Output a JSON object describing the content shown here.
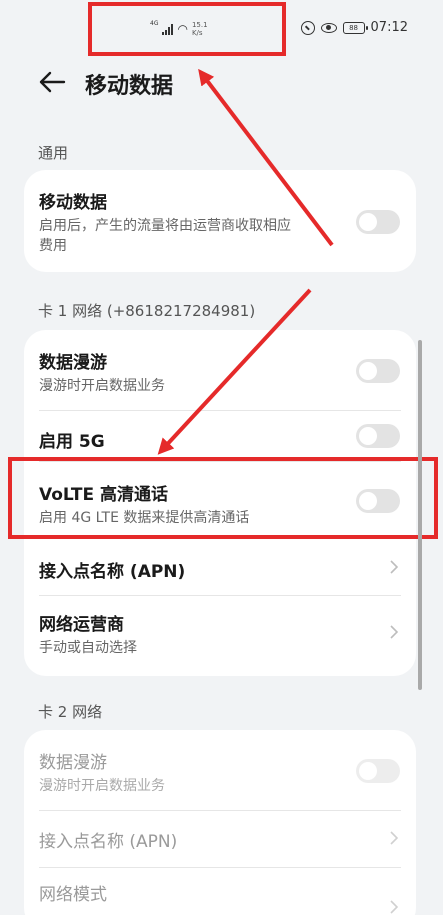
{
  "status_bar": {
    "network_type": "4G",
    "speed_value": "15.1",
    "speed_unit": "K/s",
    "battery": "88",
    "time": "07:12"
  },
  "header": {
    "title": "移动数据"
  },
  "sections": {
    "general": {
      "label": "通用",
      "mobile_data": {
        "title": "移动数据",
        "subtitle_line1": "启用后，产生的流量将由运营商收取相应",
        "subtitle_line2": "费用",
        "enabled": false
      }
    },
    "sim1": {
      "label": "卡 1 网络 (+8618217284981)",
      "roaming": {
        "title": "数据漫游",
        "subtitle": "漫游时开启数据业务",
        "enabled": false
      },
      "enable_5g": {
        "title": "启用 5G",
        "enabled": false
      },
      "volte": {
        "title": "VoLTE 高清通话",
        "subtitle": "启用 4G LTE 数据来提供高清通话",
        "enabled": false
      },
      "apn": {
        "title": "接入点名称 (APN)"
      },
      "carrier": {
        "title": "网络运营商",
        "subtitle": "手动或自动选择"
      }
    },
    "sim2": {
      "label": "卡 2 网络",
      "roaming": {
        "title": "数据漫游",
        "subtitle": "漫游时开启数据业务",
        "enabled": false
      },
      "apn": {
        "title": "接入点名称 (APN)"
      },
      "network_mode": {
        "title": "网络模式"
      }
    }
  },
  "colors": {
    "annotation": "#e52a2a",
    "background": "#f1f3f5",
    "card": "#ffffff"
  }
}
